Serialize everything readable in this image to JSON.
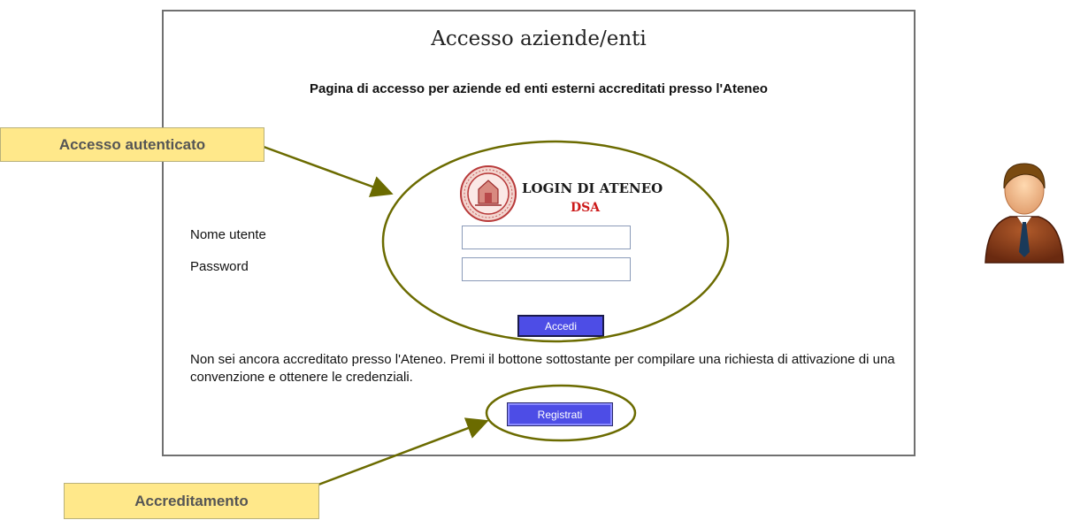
{
  "page": {
    "title": "Accesso aziende/enti",
    "subtitle": "Pagina di accesso per aziende ed enti esterni accreditati presso l'Ateneo"
  },
  "login": {
    "logo_text": "LOGIN DI ATENEO",
    "logo_subtext": "DSA",
    "username_label": "Nome utente",
    "username_value": "",
    "password_label": "Password",
    "password_value": "",
    "submit_label": "Accedi"
  },
  "registration": {
    "notice": "Non sei ancora accreditato presso l'Ateneo. Premi il bottone sottostante per compilare una richiesta di attivazione di una convenzione e ottenere le credenziali.",
    "button_label": "Registrati"
  },
  "annotations": {
    "auth_callout": "Accesso autenticato",
    "accreditation_callout": "Accreditamento",
    "highlight_color": "#6b6b00",
    "callout_color": "#ffe88a"
  },
  "icons": {
    "seal": "university-seal-icon",
    "user": "user-avatar-icon"
  }
}
